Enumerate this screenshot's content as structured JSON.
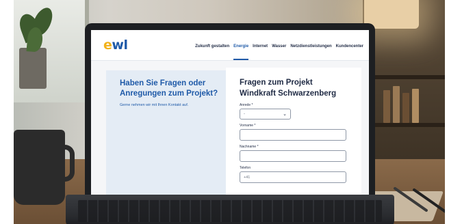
{
  "site": {
    "logo_part1": "e",
    "logo_part2": "wl",
    "nav": [
      {
        "label": "Zukunft gestalten",
        "active": false
      },
      {
        "label": "Energie",
        "active": true
      },
      {
        "label": "Internet",
        "active": false
      },
      {
        "label": "Wasser",
        "active": false
      },
      {
        "label": "Netzdienstleistungen",
        "active": false
      },
      {
        "label": "Kundencenter",
        "active": false
      }
    ]
  },
  "info": {
    "title": "Haben Sie Fragen oder Anregungen zum Projekt?",
    "text": "Gerne nehmen wir mit Ihnen Kontakt auf."
  },
  "form": {
    "title": "Fragen zum Projekt Windkraft Schwarzenberg",
    "salutation": {
      "label": "Anrede *",
      "value": "-"
    },
    "firstname": {
      "label": "Vorname *",
      "value": ""
    },
    "lastname": {
      "label": "Nachname *",
      "value": ""
    },
    "phone": {
      "label": "Telefon",
      "value": "+41"
    }
  },
  "icons": {
    "dropdown": "chevron-down-icon"
  },
  "colors": {
    "brand_blue": "#1f5aa8",
    "brand_yellow": "#f2b21b",
    "panel_blue": "#e4ecf5"
  }
}
